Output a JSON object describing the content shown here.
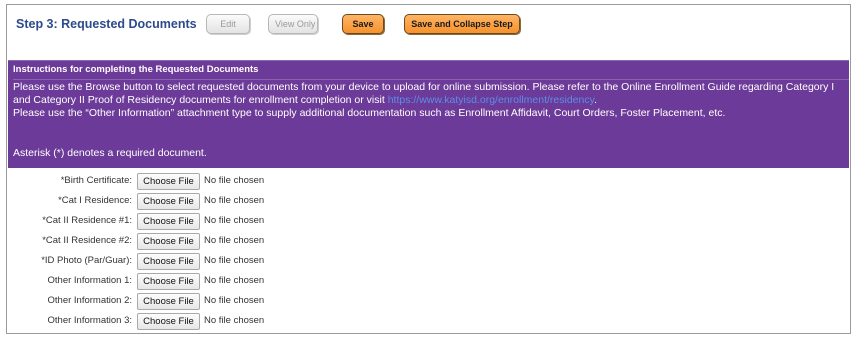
{
  "header": {
    "title": "Step 3: Requested Documents",
    "buttons": {
      "edit": "Edit",
      "view_only": "View Only",
      "save": "Save",
      "save_collapse": "Save and Collapse Step"
    }
  },
  "instructions": {
    "title": "Instructions for completing the Requested Documents",
    "para1_text": "Please use the Browse button to select requested documents from your device to upload for online submission. Please refer to the Online Enrollment Guide regarding Category I and Category II Proof of Residency documents for enrollment completion or visit",
    "para1_link": "https://www.katyisd.org/enrollment/residency",
    "para1_end": ".",
    "para2": "Please use the “Other Information” attachment type to supply additional documentation such as Enrollment Affidavit, Court Orders, Foster Placement, etc.",
    "asterisk_note": "Asterisk (*) denotes a required document."
  },
  "files": [
    {
      "label": "*Birth Certificate:",
      "button": "Choose File",
      "status": "No file chosen"
    },
    {
      "label": "*Cat I Residence:",
      "button": "Choose File",
      "status": "No file chosen"
    },
    {
      "label": "*Cat II Residence #1:",
      "button": "Choose File",
      "status": "No file chosen"
    },
    {
      "label": "*Cat II Residence #2:",
      "button": "Choose File",
      "status": "No file chosen"
    },
    {
      "label": "*ID Photo (Par/Guar):",
      "button": "Choose File",
      "status": "No file chosen"
    },
    {
      "label": "Other Information 1:",
      "button": "Choose File",
      "status": "No file chosen"
    },
    {
      "label": "Other Information 2:",
      "button": "Choose File",
      "status": "No file chosen"
    },
    {
      "label": "Other Information 3:",
      "button": "Choose File",
      "status": "No file chosen"
    }
  ],
  "colors": {
    "title_blue": "#2c4a8c",
    "panel_purple": "#6c3a98",
    "button_orange": "#f6922c",
    "link_blue": "#5b8fe8"
  }
}
